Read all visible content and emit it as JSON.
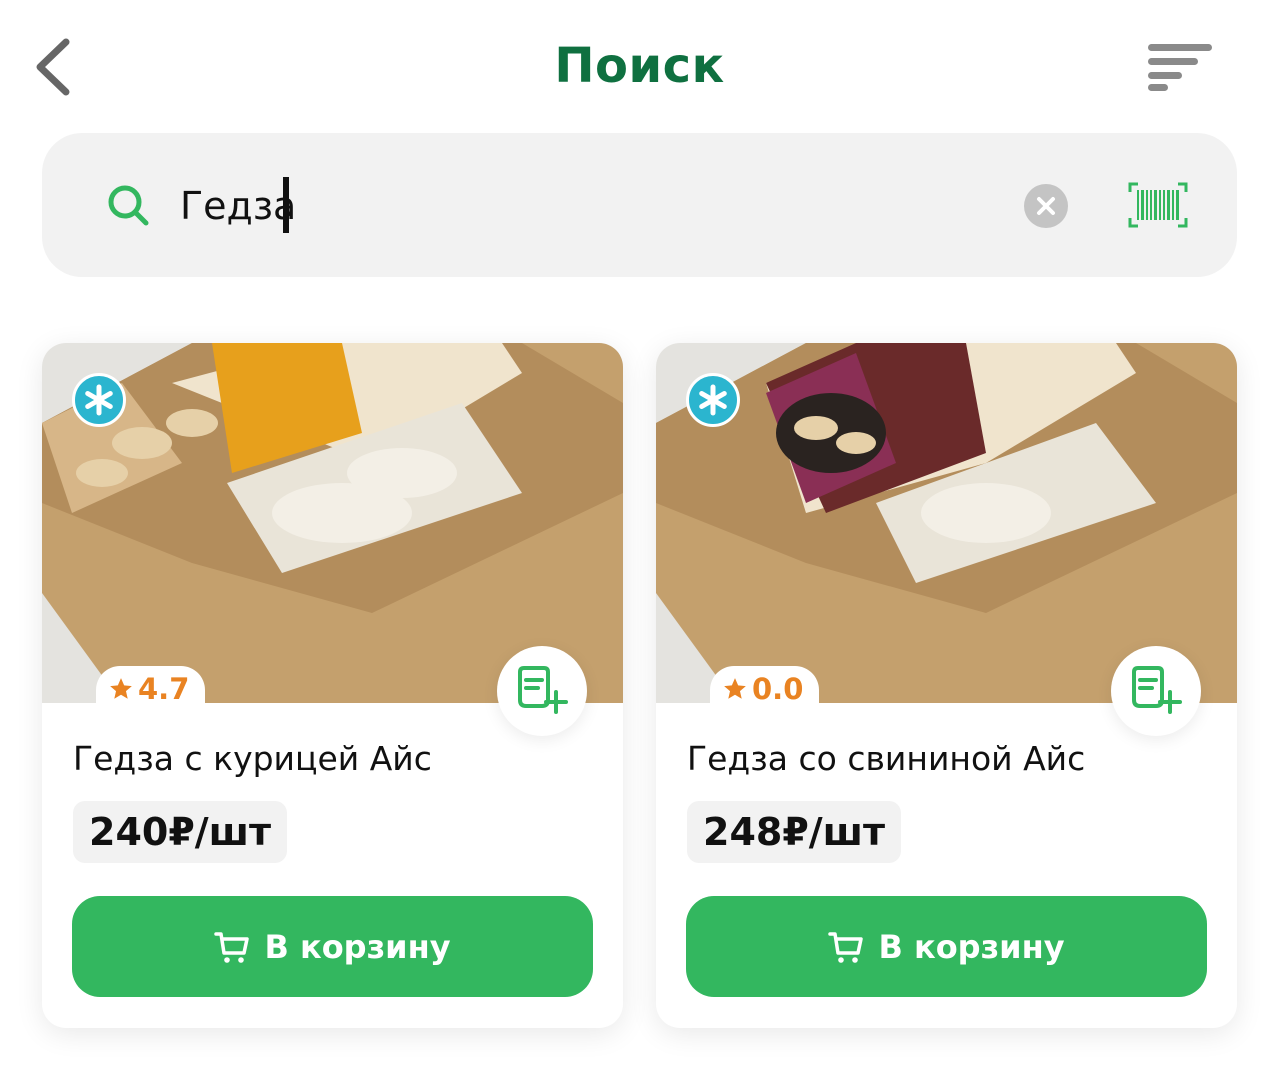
{
  "header": {
    "title": "Поиск"
  },
  "search": {
    "value": "Гедза",
    "placeholder": ""
  },
  "colors": {
    "brand_green": "#33b75f",
    "title_green": "#0f7040",
    "rating_orange": "#e98322",
    "frozen_badge": "#2bb5cf"
  },
  "products": [
    {
      "name": "Гедза с курицей Айс",
      "price": "240₽/шт",
      "rating": "4.7",
      "cart_label": "В корзину",
      "label_color": "#e7a01c",
      "badge_icon": "snowflake-icon"
    },
    {
      "name": "Гедза со свининой Айс",
      "price": "248₽/шт",
      "rating": "0.0",
      "cart_label": "В корзину",
      "label_color": "#6a2a2a",
      "badge_icon": "snowflake-icon"
    }
  ]
}
